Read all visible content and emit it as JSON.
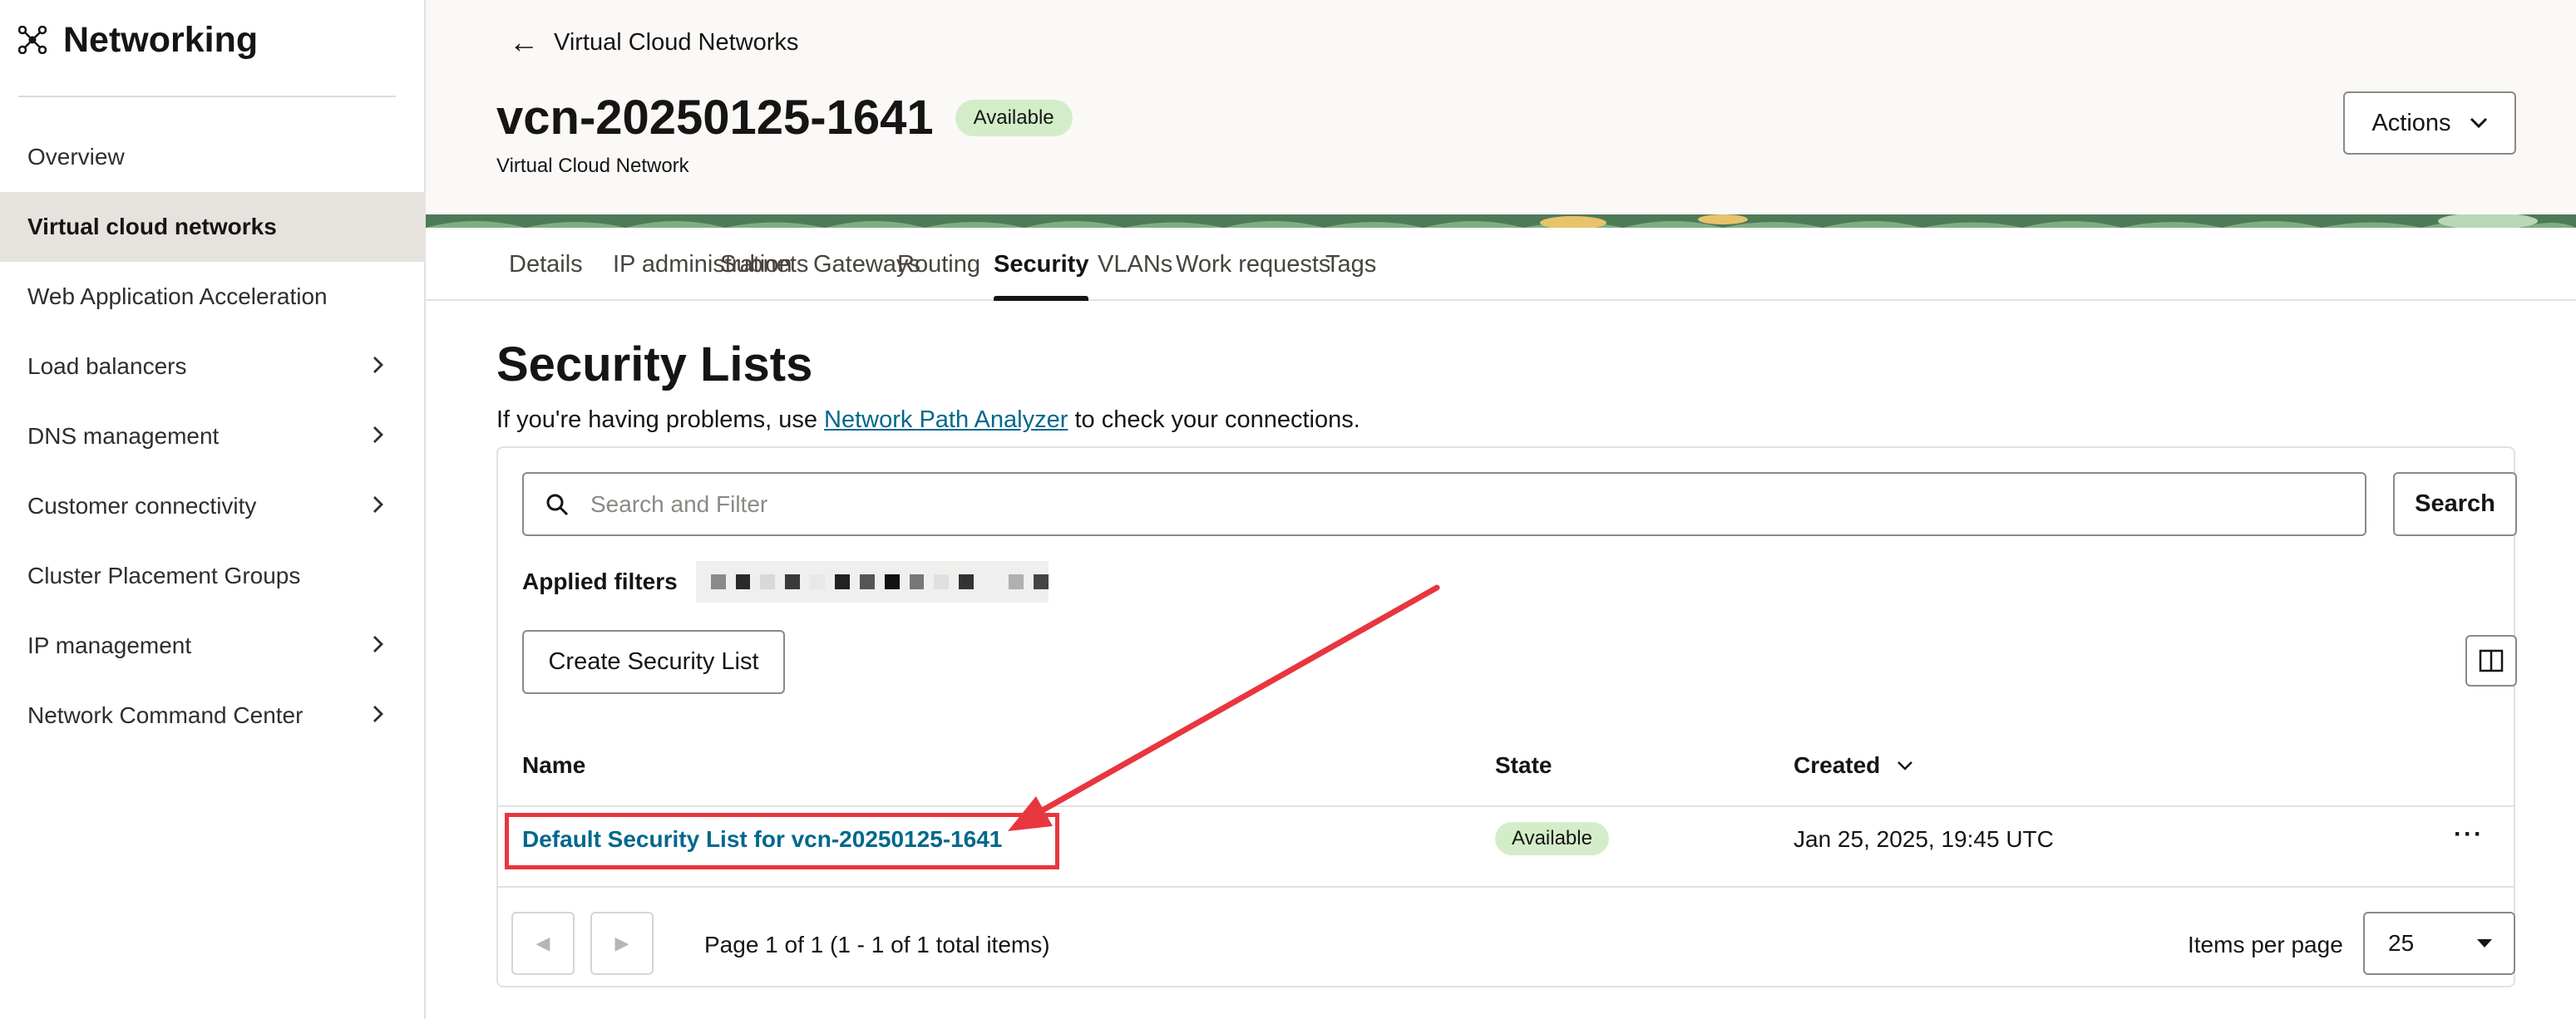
{
  "sidebar": {
    "title": "Networking",
    "items": [
      {
        "label": "Overview",
        "chevron": false,
        "active": false
      },
      {
        "label": "Virtual cloud networks",
        "chevron": false,
        "active": true
      },
      {
        "label": "Web Application Acceleration",
        "chevron": false,
        "active": false
      },
      {
        "label": "Load balancers",
        "chevron": true,
        "active": false
      },
      {
        "label": "DNS management",
        "chevron": true,
        "active": false
      },
      {
        "label": "Customer connectivity",
        "chevron": true,
        "active": false
      },
      {
        "label": "Cluster Placement Groups",
        "chevron": false,
        "active": false
      },
      {
        "label": "IP management",
        "chevron": true,
        "active": false
      },
      {
        "label": "Network Command Center",
        "chevron": true,
        "active": false
      }
    ]
  },
  "header": {
    "back_label": "Virtual Cloud Networks",
    "vcn_name": "vcn-20250125-1641",
    "status": "Available",
    "subtitle": "Virtual Cloud Network",
    "actions_label": "Actions"
  },
  "tabs": [
    "Details",
    "IP administration",
    "Subnets",
    "Gateways",
    "Routing",
    "Security",
    "VLANs",
    "Work requests",
    "Tags"
  ],
  "active_tab": "Security",
  "section": {
    "title": "Security Lists",
    "help_prefix": "If you're having problems, use ",
    "help_link": "Network Path Analyzer",
    "help_suffix": " to check your connections."
  },
  "search": {
    "placeholder": "Search and Filter",
    "button": "Search"
  },
  "applied_filters_label": "Applied filters",
  "create_button": "Create Security List",
  "table": {
    "columns": {
      "name": "Name",
      "state": "State",
      "created": "Created"
    },
    "rows": [
      {
        "name": "Default Security List for vcn-20250125-1641",
        "state": "Available",
        "created": "Jan 25, 2025, 19:45 UTC"
      }
    ]
  },
  "pagination": {
    "info": "Page 1 of 1 (1 - 1 of 1 total items)",
    "items_per_page_label": "Items per page",
    "items_per_page": "25"
  },
  "colors": {
    "accent_link": "#00688c",
    "badge_green": "#d4edc9",
    "annotation_red": "#e8363f"
  }
}
